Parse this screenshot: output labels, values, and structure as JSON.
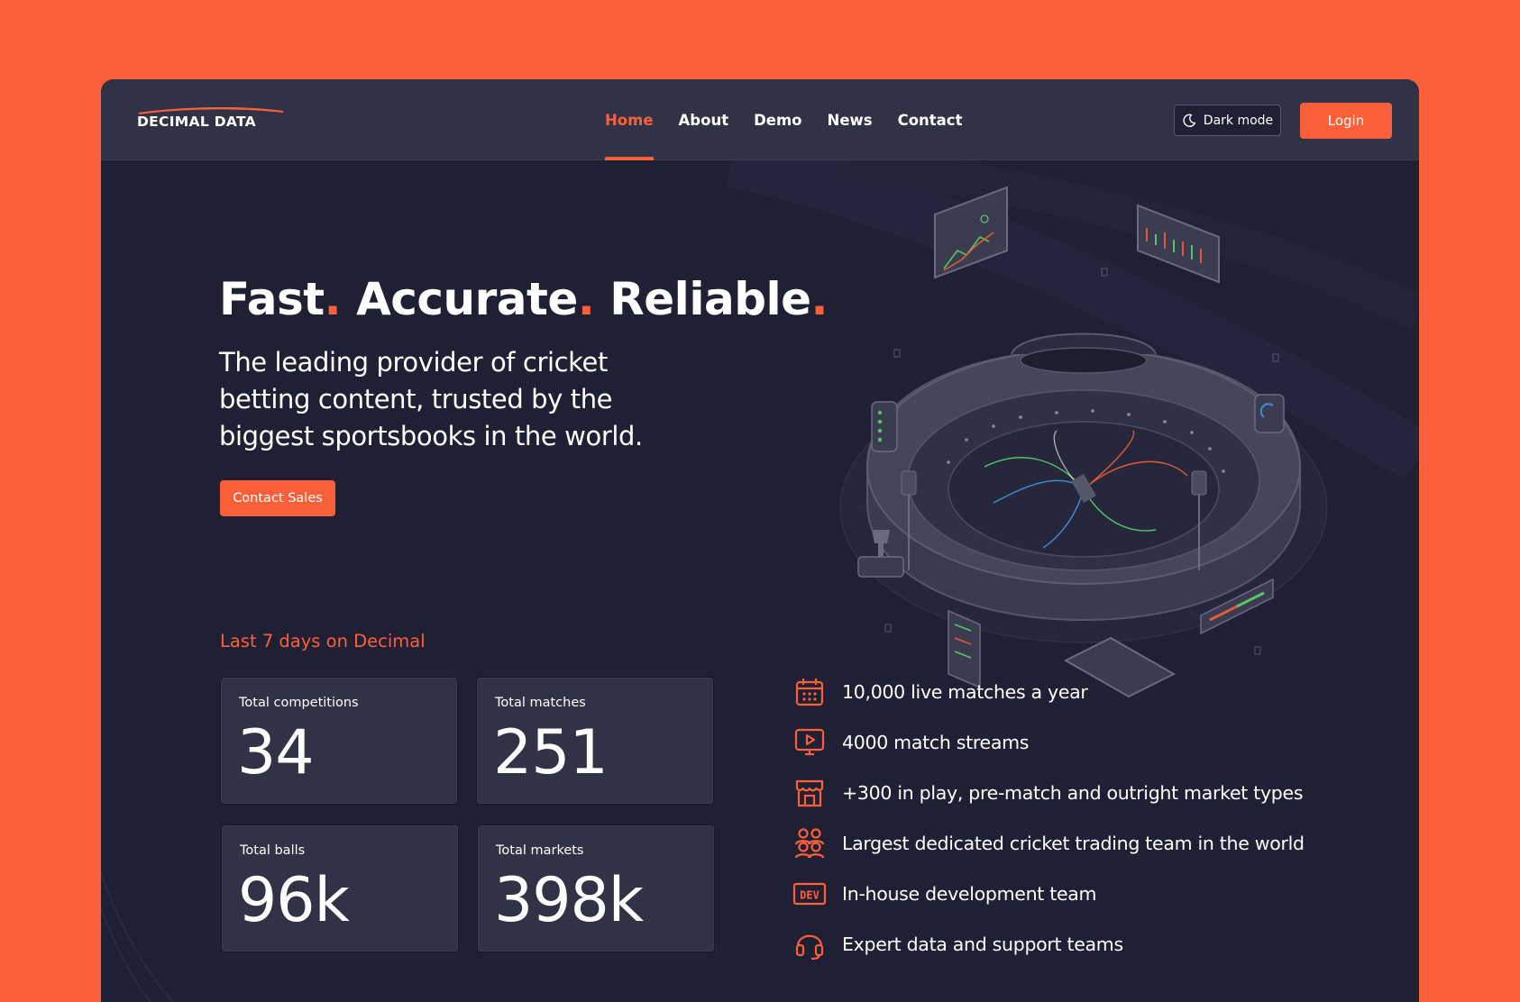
{
  "brand": {
    "logo_text": "DECIMAL DATA",
    "accent_color": "#fb603b",
    "background_color": "#1f2034",
    "header_color": "#313245"
  },
  "nav": {
    "items": [
      {
        "label": "Home",
        "active": true
      },
      {
        "label": "About",
        "active": false
      },
      {
        "label": "Demo",
        "active": false
      },
      {
        "label": "News",
        "active": false
      },
      {
        "label": "Contact",
        "active": false
      }
    ]
  },
  "header_actions": {
    "dark_mode_label": "Dark mode",
    "dark_mode_icon": "moon-icon",
    "login_label": "Login"
  },
  "hero": {
    "title_words": [
      "Fast",
      "Accurate",
      "Reliable"
    ],
    "title_punct": ".",
    "subtitle_lines": [
      "The leading provider of cricket",
      "betting content, trusted by the",
      "biggest sportsbooks in the world."
    ],
    "cta_label": "Contact Sales",
    "illustration": "isometric-cricket-stadium"
  },
  "stats": {
    "heading": "Last 7 days on Decimal",
    "cards": [
      {
        "label": "Total competitions",
        "value": "34"
      },
      {
        "label": "Total matches",
        "value": "251"
      },
      {
        "label": "Total balls",
        "value": "96k"
      },
      {
        "label": "Total markets",
        "value": "398k"
      }
    ]
  },
  "features": [
    {
      "icon": "calendar-icon",
      "text": "10,000 live matches a year"
    },
    {
      "icon": "video-play-icon",
      "text": "4000 match streams"
    },
    {
      "icon": "store-icon",
      "text": "+300 in play, pre-match  and outright market types"
    },
    {
      "icon": "team-icon",
      "text": "Largest dedicated cricket trading team in the world"
    },
    {
      "icon": "dev-icon",
      "text": "In-house development team",
      "icon_text": "DEV"
    },
    {
      "icon": "headset-icon",
      "text": "Expert data and support teams"
    }
  ]
}
